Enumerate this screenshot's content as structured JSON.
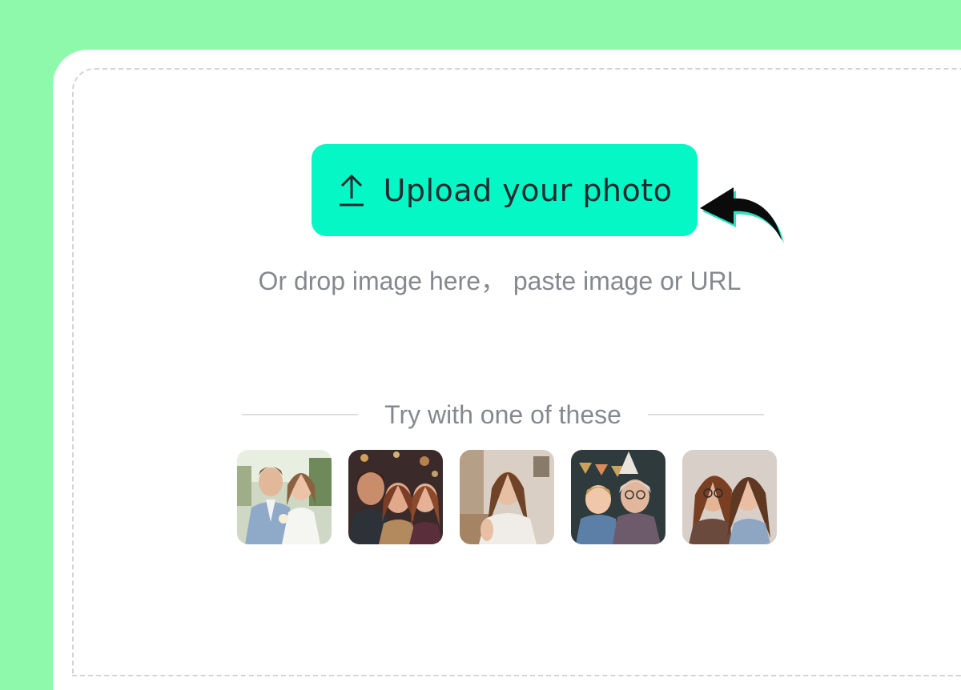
{
  "upload": {
    "label": "Upload your photo",
    "icon": "upload-icon",
    "color": "#06f7c6"
  },
  "hint": "Or drop image here， paste image or URL",
  "samples": {
    "heading": "Try with one of these",
    "items": [
      {
        "name": "sample-wedding-couple"
      },
      {
        "name": "sample-friends-group"
      },
      {
        "name": "sample-woman-selfie"
      },
      {
        "name": "sample-boy-grandmother"
      },
      {
        "name": "sample-two-women"
      }
    ]
  },
  "colors": {
    "background": "#8ef9ab",
    "accent": "#06f7c6",
    "text_muted": "#85898f"
  }
}
